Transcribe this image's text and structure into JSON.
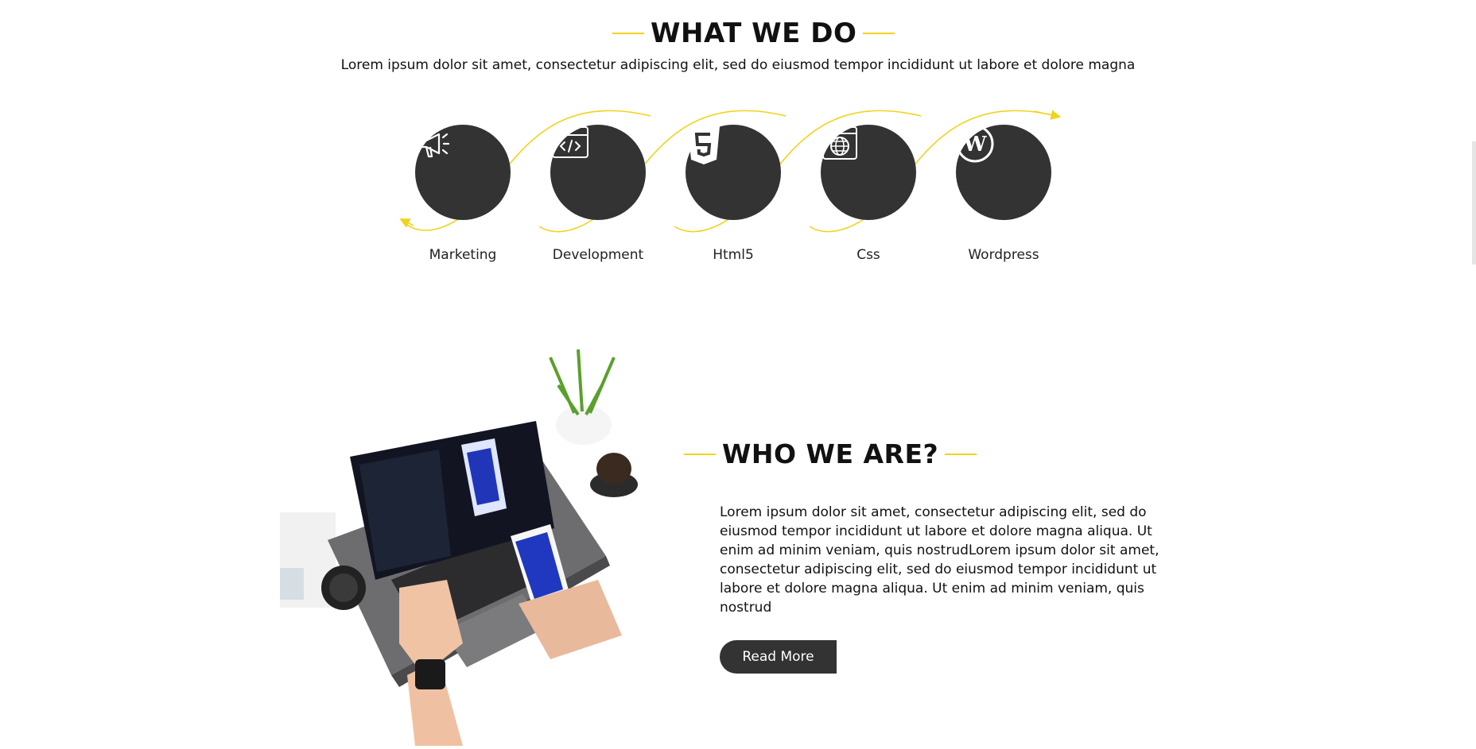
{
  "what_we_do": {
    "title": "WHAT WE DO",
    "subtitle": "Lorem ipsum dolor sit amet, consectetur adipiscing elit, sed do eiusmod tempor incididunt ut labore et dolore magna"
  },
  "services": [
    {
      "label": "Marketing",
      "icon": "megaphone-icon"
    },
    {
      "label": "Development",
      "icon": "code-window-icon"
    },
    {
      "label": "Html5",
      "icon": "html5-icon"
    },
    {
      "label": "Css",
      "icon": "globe-window-icon"
    },
    {
      "label": "Wordpress",
      "icon": "wordpress-icon"
    }
  ],
  "who_we_are": {
    "title": "WHO WE ARE?",
    "text": "Lorem ipsum dolor sit amet, consectetur adipiscing elit, sed do eiusmod tempor incididunt ut labore et dolore magna aliqua. Ut enim ad minim veniam, quis nostrudLorem ipsum dolor sit amet, consectetur adipiscing elit, sed do eiusmod tempor incididunt ut labore et dolore magna aliqua. Ut enim ad minim veniam, quis nostrud",
    "button_label": "Read More"
  },
  "colors": {
    "accent": "#f2d31d",
    "circle": "#333333",
    "button": "#333333"
  }
}
